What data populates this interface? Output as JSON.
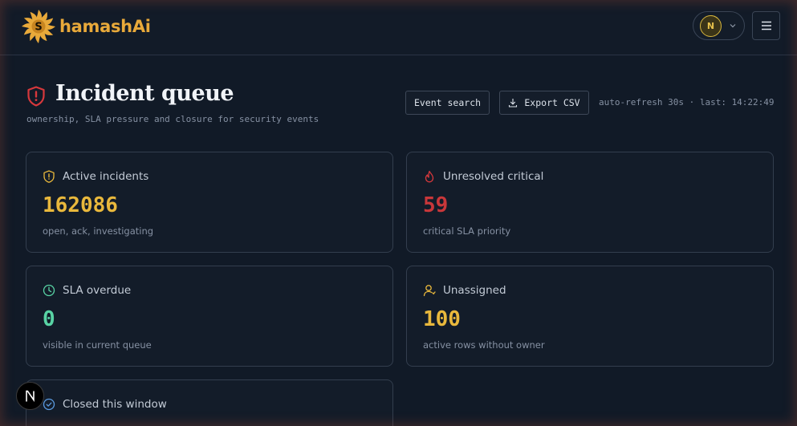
{
  "brand": {
    "name": "hamashAi",
    "mark_letter": "S"
  },
  "user": {
    "initial": "N"
  },
  "page": {
    "title": "Incident queue",
    "subtitle": "ownership, SLA pressure and closure for security events",
    "actions": {
      "search_label": "Event search",
      "export_label": "Export CSV"
    },
    "refresh_status": "auto-refresh 30s · last: 14:22:49"
  },
  "cards": [
    {
      "icon": "shield-alert-icon",
      "label": "Active incidents",
      "value": "162086",
      "sub": "open, ack, investigating",
      "color": "#e9b83c"
    },
    {
      "icon": "flame-icon",
      "label": "Unresolved critical",
      "value": "59",
      "sub": "critical SLA priority",
      "color": "#c9373a"
    },
    {
      "icon": "clock-icon",
      "label": "SLA overdue",
      "value": "0",
      "sub": "visible in current queue",
      "color": "#58d3a4"
    },
    {
      "icon": "user-icon",
      "label": "Unassigned",
      "value": "100",
      "sub": "active rows without owner",
      "color": "#e9b83c"
    },
    {
      "icon": "check-circle-icon",
      "label": "Closed this window"
    }
  ],
  "dev_badge": {
    "letter": "N"
  }
}
